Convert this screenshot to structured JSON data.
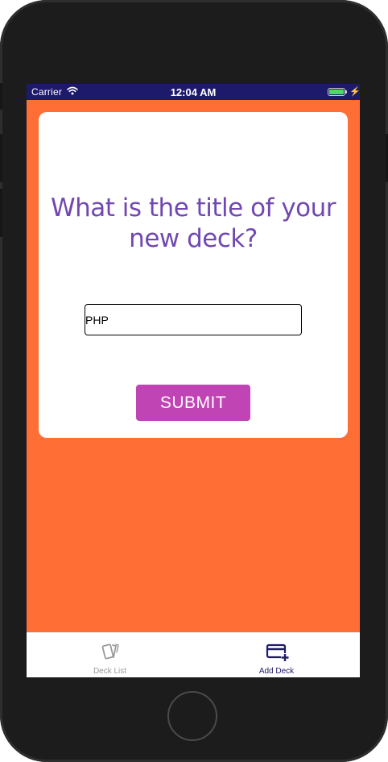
{
  "status_bar": {
    "carrier": "Carrier",
    "time": "12:04 AM",
    "battery_color": "#4cd964"
  },
  "screen": {
    "background_color": "#ff6f35"
  },
  "form": {
    "question": "What is the title of your new deck?",
    "input_value": "PHP",
    "submit_label": "SUBMIT",
    "question_color": "#7048b0",
    "submit_color": "#c044b4"
  },
  "tab_bar": {
    "tabs": [
      {
        "label": "Deck List",
        "icon": "cards-icon",
        "active": false
      },
      {
        "label": "Add Deck",
        "icon": "add-card-icon",
        "active": true
      }
    ]
  }
}
